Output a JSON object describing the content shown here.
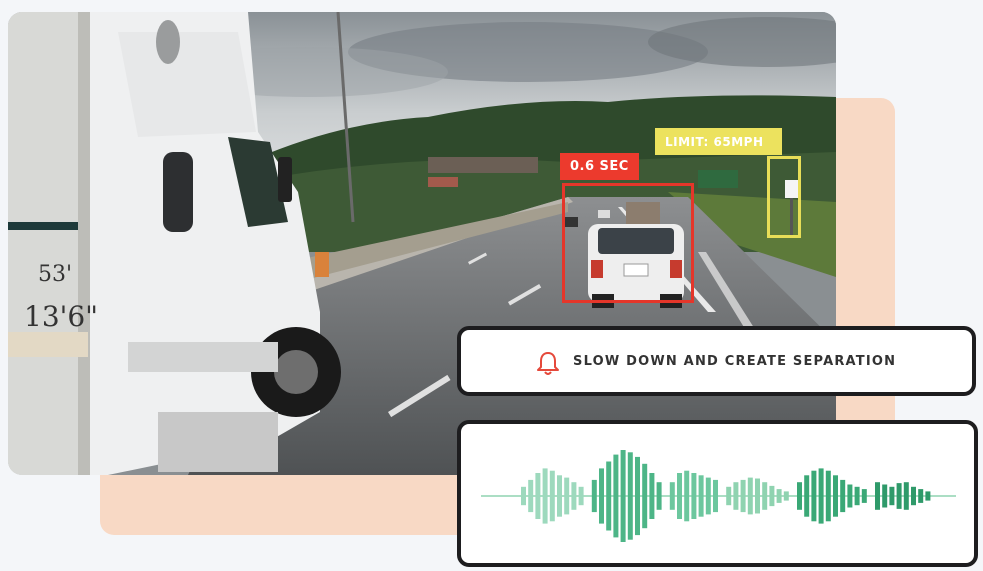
{
  "detections": {
    "timing_label": "0.6 SEC",
    "limit_label": "LIMIT: 65MPH"
  },
  "alert": {
    "icon": "bell-icon",
    "message": "SLOW DOWN AND CREATE SEPARATION"
  },
  "truck": {
    "plate_top": "53'",
    "plate_bottom": "13'6\""
  },
  "colors": {
    "alert_red": "#ec3a2d",
    "limit_yellow": "#ece25e",
    "peach_backdrop": "#f8d9c5",
    "wave_green": "#3aa876",
    "wave_light": "#8fd3b0"
  },
  "waveform": {
    "groups": [
      {
        "color": "#9dd9bd",
        "bars": [
          0.2,
          0.35,
          0.5,
          0.6,
          0.55,
          0.45,
          0.4,
          0.3,
          0.2
        ]
      },
      {
        "color": "#4db587",
        "bars": [
          0.35,
          0.6,
          0.75,
          0.9,
          1.0,
          0.95,
          0.85,
          0.7,
          0.5,
          0.3
        ]
      },
      {
        "color": "#6cc79e",
        "bars": [
          0.3,
          0.5,
          0.55,
          0.5,
          0.45,
          0.4,
          0.35
        ]
      },
      {
        "color": "#8fd3b0",
        "bars": [
          0.2,
          0.3,
          0.35,
          0.4,
          0.38,
          0.3,
          0.22,
          0.15,
          0.1
        ]
      },
      {
        "color": "#3aa876",
        "bars": [
          0.3,
          0.45,
          0.55,
          0.6,
          0.55,
          0.45,
          0.35,
          0.25,
          0.2,
          0.15
        ]
      },
      {
        "color": "#2f9a6a",
        "bars": [
          0.3,
          0.25,
          0.2,
          0.28,
          0.3,
          0.2,
          0.15,
          0.1
        ]
      }
    ]
  }
}
